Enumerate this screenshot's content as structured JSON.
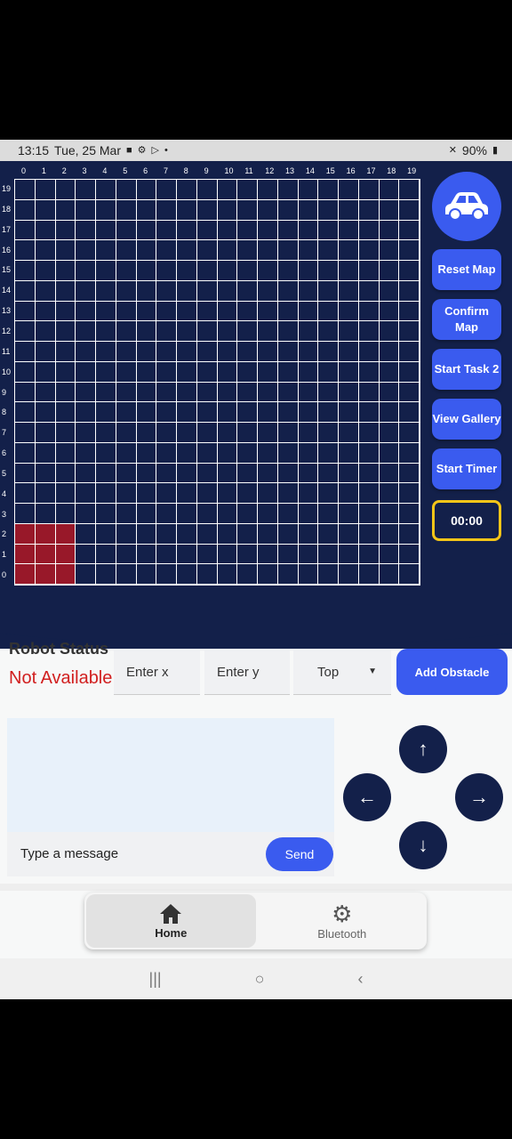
{
  "status_bar": {
    "time": "13:15",
    "date": "Tue, 25 Mar",
    "battery": "90%"
  },
  "grid": {
    "cols": [
      "0",
      "1",
      "2",
      "3",
      "4",
      "5",
      "6",
      "7",
      "8",
      "9",
      "10",
      "11",
      "12",
      "13",
      "14",
      "15",
      "16",
      "17",
      "18",
      "19"
    ],
    "rows": [
      "19",
      "18",
      "17",
      "16",
      "15",
      "14",
      "13",
      "12",
      "11",
      "10",
      "9",
      "8",
      "7",
      "6",
      "5",
      "4",
      "3",
      "2",
      "1",
      "0"
    ],
    "robot_cells": [
      [
        0,
        0
      ],
      [
        1,
        0
      ],
      [
        2,
        0
      ],
      [
        0,
        1
      ],
      [
        1,
        1
      ],
      [
        2,
        1
      ],
      [
        0,
        2
      ],
      [
        1,
        2
      ],
      [
        2,
        2
      ]
    ]
  },
  "side": {
    "car_icon": "car-icon",
    "reset": "Reset Map",
    "confirm": "Confirm Map",
    "task2": "Start Task 2",
    "gallery": "View Gallery",
    "start_timer": "Start Timer",
    "timer": "00:00"
  },
  "robot_status": {
    "title": "Robot Status",
    "value": "Not Available"
  },
  "obstacle_form": {
    "x_placeholder": "Enter x",
    "y_placeholder": "Enter y",
    "direction": "Top",
    "add_label": "Add Obstacle"
  },
  "chat": {
    "placeholder": "Type a message",
    "send": "Send"
  },
  "dpad": {
    "up": "↑",
    "left": "←",
    "right": "→",
    "down": "↓"
  },
  "nav": {
    "home": "Home",
    "bluetooth": "Bluetooth"
  },
  "colors": {
    "navy": "#13204a",
    "accent": "#3a5bef",
    "robot": "#981829",
    "timer_border": "#f5c518",
    "status_red": "#d11f1f"
  }
}
